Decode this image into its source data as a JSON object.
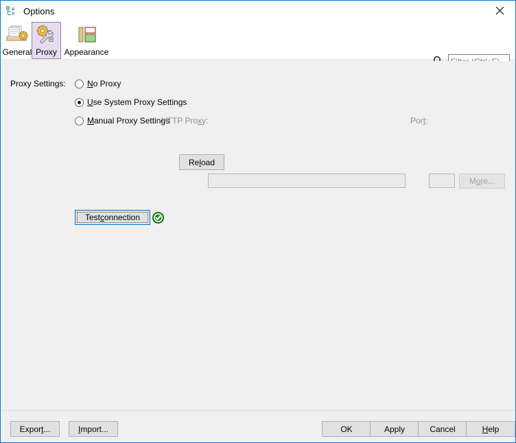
{
  "window": {
    "title": "Options",
    "icon": "tree-rr-icon",
    "close_label": "close-icon",
    "border_color": "#0078d7"
  },
  "toolbar": {
    "tabs": [
      {
        "label": "General",
        "icon": "documents-gear-icon",
        "selected": false
      },
      {
        "label": "Proxy",
        "icon": "gear-wrench-icon",
        "selected": true
      },
      {
        "label": "Appearance",
        "icon": "layout-blocks-icon",
        "selected": false
      }
    ],
    "selected_tab": "Proxy",
    "selected_tab_bg": "#e6dcf0",
    "selected_tab_border": "#9b79c4"
  },
  "search": {
    "icon": "search-icon",
    "placeholder": "Filter (Ctrl+F)",
    "value": ""
  },
  "main": {
    "section_label": "Proxy Settings:",
    "options": [
      {
        "id": "no-proxy",
        "label_pre": "",
        "label_mnemonic": "N",
        "label_post": "o Proxy",
        "checked": false,
        "enabled": true
      },
      {
        "id": "use-system-proxy",
        "label_pre": "",
        "label_mnemonic": "U",
        "label_post": "se System Proxy Settings",
        "checked": true,
        "enabled": true
      },
      {
        "id": "manual-proxy",
        "label_pre": "",
        "label_mnemonic": "M",
        "label_post": "anual Proxy Settings",
        "checked": false,
        "enabled": true
      }
    ],
    "reload_button": {
      "pre": "Re",
      "mnemonic": "l",
      "post": "oad",
      "enabled": true
    },
    "http_proxy_label": {
      "pre": "HTTP Pro",
      "mnemonic": "x",
      "post": "y:",
      "enabled": false
    },
    "http_proxy_value": "",
    "port_label": {
      "pre": "Por",
      "mnemonic": "t",
      "post": ":",
      "enabled": false
    },
    "port_value": "",
    "more_button": {
      "pre": "M",
      "mnemonic": "o",
      "post": "re...",
      "enabled": false
    },
    "test_connection_button": {
      "pre": "Test ",
      "mnemonic": "c",
      "post": "onnection",
      "focused": true
    },
    "test_status": {
      "icon": "success-check-icon",
      "color": "#2b9b2b",
      "state": "success"
    }
  },
  "footer": {
    "buttons": [
      {
        "id": "export",
        "pre": "Expor",
        "mnemonic": "t",
        "post": "..."
      },
      {
        "id": "import",
        "pre": "",
        "mnemonic": "I",
        "post": "mport..."
      },
      {
        "id": "ok",
        "pre": "OK",
        "mnemonic": "",
        "post": ""
      },
      {
        "id": "apply",
        "pre": "Apply",
        "mnemonic": "",
        "post": ""
      },
      {
        "id": "cancel",
        "pre": "Cancel",
        "mnemonic": "",
        "post": ""
      },
      {
        "id": "help",
        "pre": "",
        "mnemonic": "H",
        "post": "elp"
      }
    ]
  }
}
